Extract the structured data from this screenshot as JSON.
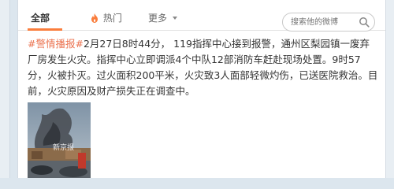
{
  "tabs": [
    {
      "label": "全部"
    },
    {
      "label": "热门"
    },
    {
      "label": "更多"
    }
  ],
  "search": {
    "placeholder": "搜索他的微博"
  },
  "post": {
    "topic": "#警情播报#",
    "text": "2月27日8时44分， 119指挥中心接到报警，通州区梨园镇一废弃厂房发生火灾。指挥中心立即调派4个中队12部消防车赶赴现场处置。9时57分，火被扑灭。过火面积200平米，火灾致3人面部轻微灼伤，已送医院救治。目前，火灾原因及财产损失正在调查中。"
  },
  "photo": {
    "watermark": "新京报"
  },
  "colors": {
    "accent": "#fa7d3c",
    "topic": "#eb7350",
    "background": "#dce6ee"
  },
  "icons": {
    "hot": "flame-icon",
    "more": "chevron-down-icon",
    "search": "search-icon"
  }
}
